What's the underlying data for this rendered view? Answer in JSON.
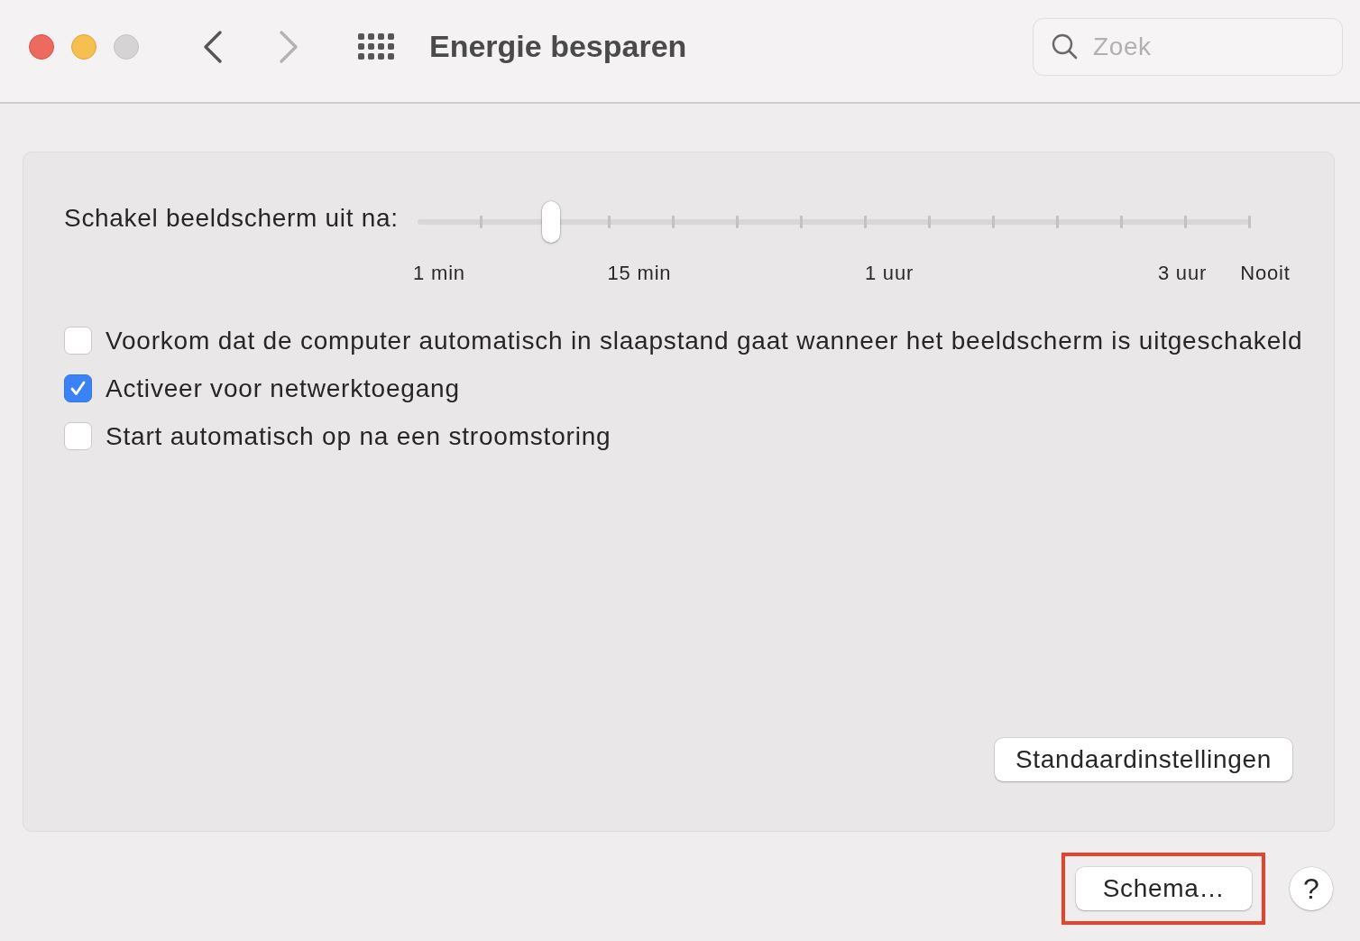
{
  "window": {
    "controls": [
      {
        "kind": "close",
        "disabled": false
      },
      {
        "kind": "minimize",
        "disabled": false
      },
      {
        "kind": "zoom",
        "disabled": true
      }
    ],
    "navigation": [
      {
        "kind": "back",
        "disabled": false
      },
      {
        "kind": "forward",
        "disabled": true
      }
    ],
    "title": "Energie besparen"
  },
  "search": {
    "placeholder": "Zoek"
  },
  "display_sleep": {
    "label": "Schakel beeldscherm uit na:",
    "level": 0.16,
    "tick_labels": [
      "1 min",
      "15 min",
      "1 uur",
      "3 uur",
      "Nooit"
    ]
  },
  "options": [
    {
      "label": "Voorkom dat de computer automatisch in slaapstand gaat wanneer het beeldscherm is uitgeschakeld",
      "checked": false
    },
    {
      "label": "Activeer voor netwerktoegang",
      "checked": true
    },
    {
      "label": "Start automatisch op na een stroomstoring",
      "checked": false
    }
  ],
  "panel_button": {
    "label": "Standaardinstellingen"
  },
  "schedule_button": {
    "label": "Schema…",
    "highlighted": true
  },
  "help_button": {
    "label": "?"
  }
}
